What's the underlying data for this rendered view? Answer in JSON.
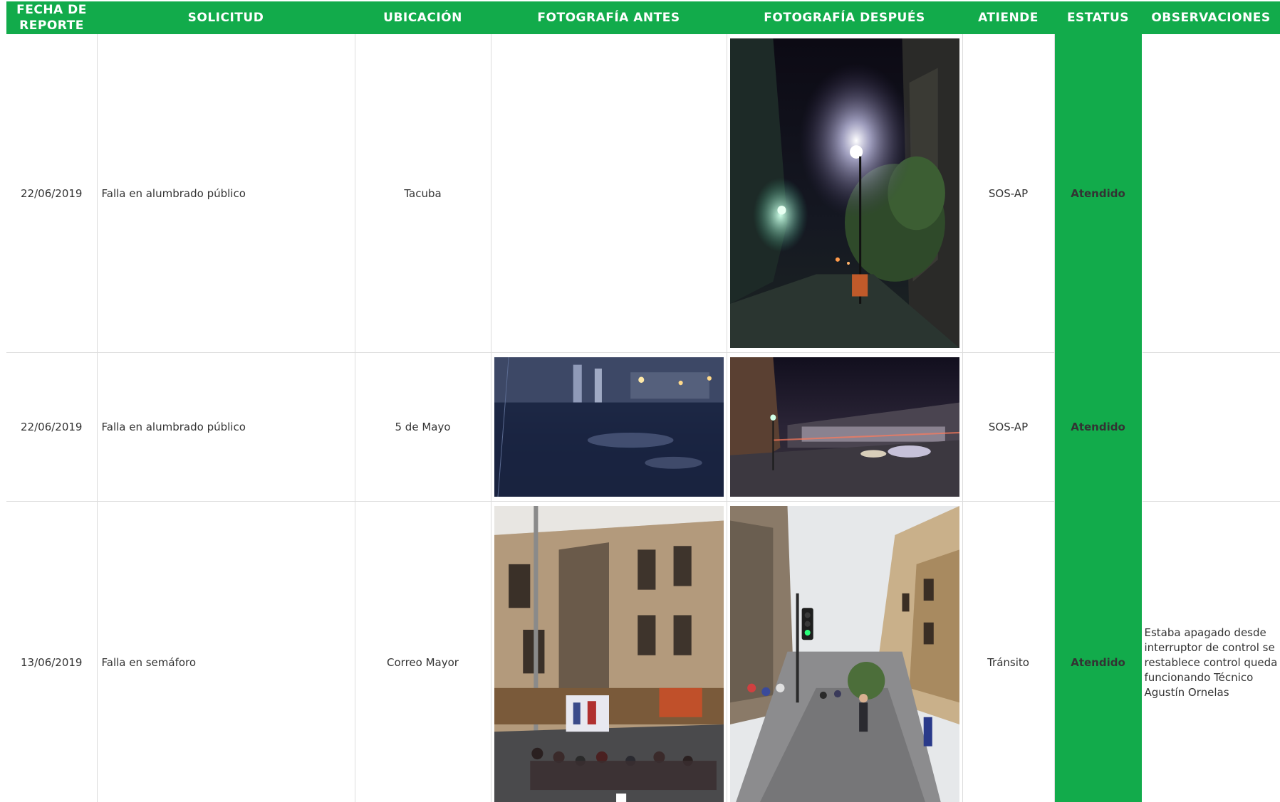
{
  "table": {
    "headers": {
      "date": "FECHA DE REPORTE",
      "request": "SOLICITUD",
      "location": "UBICACIÓN",
      "photo_before": "FOTOGRAFÍA ANTES",
      "photo_after": "FOTOGRAFÍA DESPUÉS",
      "attends": "ATIENDE",
      "status": "ESTATUS",
      "observations": "OBSERVACIONES"
    },
    "rows": [
      {
        "date": "22/06/2019",
        "request": "Falla en alumbrado público",
        "location": "Tacuba",
        "photo_before": "",
        "photo_after": "night-street-lamp-photo",
        "attends": "SOS-AP",
        "status": "Atendido",
        "observations": ""
      },
      {
        "date": "22/06/2019",
        "request": "Falla en alumbrado público",
        "location": "5 de Mayo",
        "photo_before": "night-wet-plaza-photo",
        "photo_after": "night-avenue-traffic-photo",
        "attends": "SOS-AP",
        "status": "Atendido",
        "observations": ""
      },
      {
        "date": "13/06/2019",
        "request": "Falla en semáforo",
        "location": "Correo Mayor",
        "photo_before": "colonial-building-corner-photo",
        "photo_after": "pedestrian-street-traffic-light-photo",
        "attends": "Tránsito",
        "status": "Atendido",
        "observations": "Estaba apagado desde interruptor de control se restablece control queda funcionando  Técnico Agustín Ornelas",
        "observation_lines": [
          "Estaba apagado desde",
          "interruptor de control se",
          "restablece control queda",
          "funcionando  Técnico",
          "Agustín Ornelas"
        ]
      }
    ]
  },
  "colors": {
    "header_green": "#12ab4b",
    "status_green": "#12ab4b",
    "grid_line": "#dcdcdc",
    "text": "#333333"
  }
}
